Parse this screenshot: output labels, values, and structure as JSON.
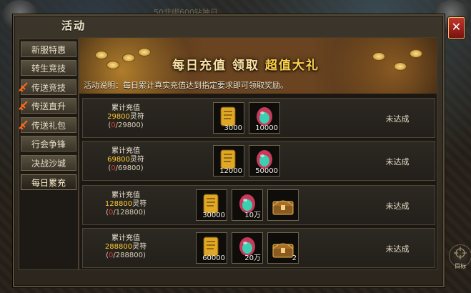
{
  "window": {
    "title": "活动",
    "close_label": "✕",
    "ticker": "50非绑600钻独日"
  },
  "sidebar": {
    "items": [
      {
        "label": "新服特惠",
        "active": false,
        "flag": false
      },
      {
        "label": "转生竞技",
        "active": false,
        "flag": false
      },
      {
        "label": "传送竞技",
        "active": false,
        "flag": true
      },
      {
        "label": "传送直升",
        "active": false,
        "flag": true
      },
      {
        "label": "传送礼包",
        "active": false,
        "flag": true
      },
      {
        "label": "行会争锋",
        "active": false,
        "flag": false
      },
      {
        "label": "决战沙城",
        "active": false,
        "flag": false
      },
      {
        "label": "每日累充",
        "active": true,
        "flag": false
      }
    ]
  },
  "banner": {
    "title_part1": "每日充值",
    "title_part2": "领取",
    "title_part3": "超值大礼",
    "description": "活动说明：每日累计真实充值达到指定要求即可领取奖励。"
  },
  "rows": [
    {
      "label": "累计充值",
      "amount": "29800",
      "unit": "灵符",
      "current": "0",
      "target": "/29800",
      "rewards": [
        {
          "icon": "gold-scroll-icon",
          "count": "3000"
        },
        {
          "icon": "gem-egg-icon",
          "count": "10000"
        }
      ],
      "status": "未达成"
    },
    {
      "label": "累计充值",
      "amount": "69800",
      "unit": "灵符",
      "current": "0",
      "target": "/69800",
      "rewards": [
        {
          "icon": "gold-scroll-icon",
          "count": "12000"
        },
        {
          "icon": "gem-egg-icon",
          "count": "50000"
        }
      ],
      "status": "未达成"
    },
    {
      "label": "累计充值",
      "amount": "128800",
      "unit": "灵符",
      "current": "0",
      "target": "/128800",
      "rewards": [
        {
          "icon": "gold-scroll-icon",
          "count": "30000"
        },
        {
          "icon": "gem-egg-icon",
          "count": "10万"
        },
        {
          "icon": "treasure-chest-icon",
          "count": ""
        }
      ],
      "status": "未达成"
    },
    {
      "label": "累计充值",
      "amount": "288800",
      "unit": "灵符",
      "current": "0",
      "target": "/288800",
      "rewards": [
        {
          "icon": "gold-scroll-icon",
          "count": "60000"
        },
        {
          "icon": "gem-egg-icon",
          "count": "20万"
        },
        {
          "icon": "treasure-chest-icon",
          "count": "2"
        }
      ],
      "status": "未达成"
    }
  ],
  "hud": {
    "target_label": "目标"
  },
  "colors": {
    "amount": "#ffcc33",
    "current_progress": "#e23a2a",
    "close_button": "#c2352a"
  }
}
